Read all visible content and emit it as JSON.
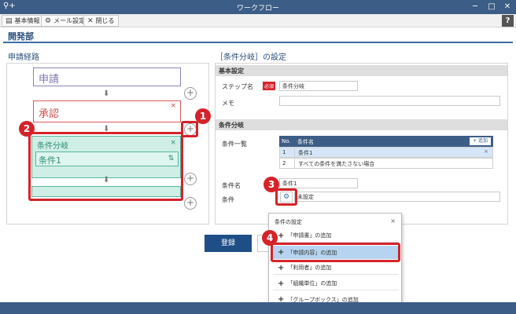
{
  "window": {
    "title": "ワークフロー",
    "minimize": "─",
    "maximize": "□",
    "close": "✕",
    "app_icon": "search-plus-icon"
  },
  "toolbar": {
    "basic_info": "基本情報",
    "mail_settings": "メール設定",
    "close": "閉じる",
    "help": "?"
  },
  "page_title": "開発部",
  "route": {
    "section_title": "申請経路",
    "apply_node": "申請",
    "approve_node": "承認",
    "branch_label": "条件分岐",
    "condition_label": "条件1",
    "close_mark": "×",
    "sort_mark": "⇅",
    "arrow": "⬇",
    "plus": "+"
  },
  "settings": {
    "section_title": "［条件分岐］の設定",
    "basic_header": "基本設定",
    "step_name_label": "ステップ名",
    "required_badge": "必須",
    "step_name_value": "条件分岐",
    "memo_label": "メモ",
    "memo_value": "",
    "branch_header": "条件分岐",
    "list_label": "条件一覧",
    "table": {
      "col_no": "No.",
      "col_name": "条件名",
      "add_button": "+ 追加",
      "rows": [
        {
          "no": "1",
          "name": "条件1",
          "selected": true
        },
        {
          "no": "2",
          "name": "すべての条件を満たさない場合",
          "selected": false
        }
      ]
    },
    "condition_name_label": "条件名",
    "condition_name_value": "条件1",
    "condition_label": "条件",
    "condition_value": "未設定",
    "gear": "⚙"
  },
  "buttons": {
    "register": "登録"
  },
  "popup": {
    "title": "条件の設定",
    "close": "×",
    "items": [
      "「申請書」の追加",
      "「申請内容」の追加",
      "「利用者」の追加",
      "「組織単位」の追加",
      "「グループボックス」の追加"
    ]
  },
  "badges": [
    "1",
    "2",
    "3",
    "4"
  ],
  "colors": {
    "accent": "#3c5d86",
    "highlight": "#d4232a",
    "branch": "#55b79c"
  }
}
